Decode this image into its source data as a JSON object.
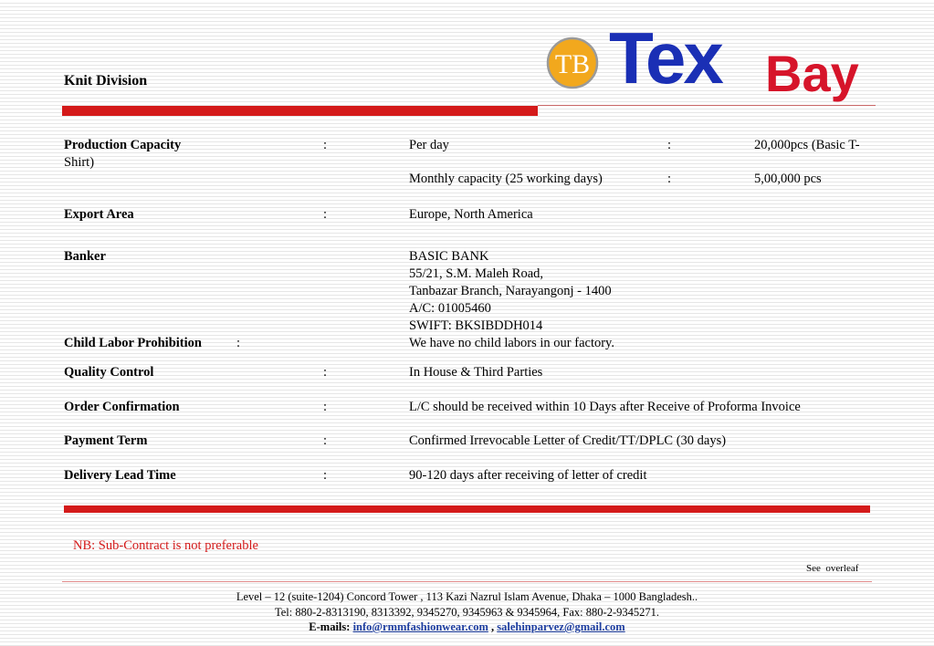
{
  "header": {
    "title": "Knit Division",
    "logo_tex": "Tex",
    "logo_bay": "Bay",
    "logo_mark": "TB"
  },
  "colon": ":",
  "rows": {
    "production_capacity": {
      "label": "Production Capacity",
      "item1": "Per day",
      "value1": "20,000pcs (Basic T-",
      "value1_wrap": "Shirt)",
      "item2": "Monthly capacity (25 working days)",
      "value2": "5,00,000 pcs"
    },
    "export_area": {
      "label": "Export Area",
      "value": "Europe, North America"
    },
    "banker": {
      "label": "Banker",
      "lines": [
        "BASIC BANK",
        "55/21, S.M. Maleh Road,",
        "Tanbazar Branch, Narayangonj - 1400",
        "A/C: 01005460",
        "SWIFT: BKSIBDDH014"
      ]
    },
    "child_labor": {
      "label": "Child Labor Prohibition",
      "value": "We have no child labors in our factory."
    },
    "quality_control": {
      "label": "Quality Control",
      "value": "In House & Third Parties"
    },
    "order_confirmation": {
      "label": "Order Confirmation",
      "value": "L/C should be received within 10 Days after Receive of Proforma Invoice"
    },
    "payment_term": {
      "label": "Payment Term",
      "value": "Confirmed Irrevocable Letter of Credit/TT/DPLC (30 days)"
    },
    "delivery_lead_time": {
      "label": "Delivery Lead Time",
      "value": "90-120 days after receiving of letter of credit"
    }
  },
  "nb_note": "NB: Sub-Contract is not preferable",
  "see_overleaf": "See  overleaf",
  "footer": {
    "address": "Level – 12 (suite-1204) Concord Tower , 113 Kazi Nazrul Islam Avenue, Dhaka – 1000 Bangladesh..",
    "tel": "Tel: 880-2-8313190, 8313392, 9345270, 9345963 & 9345964, Fax: 880-2-9345271.",
    "emails_label": "E-mails:",
    "email1": "info@rmmfashionwear.com",
    "email_separator": ",",
    "email2": "salehinparvez@gmail.com"
  },
  "colors": {
    "accent_red": "#d41a1a",
    "logo_blue": "#1a2fb5",
    "logo_orange": "#f2a81d",
    "link_blue": "#1f3fa0"
  }
}
